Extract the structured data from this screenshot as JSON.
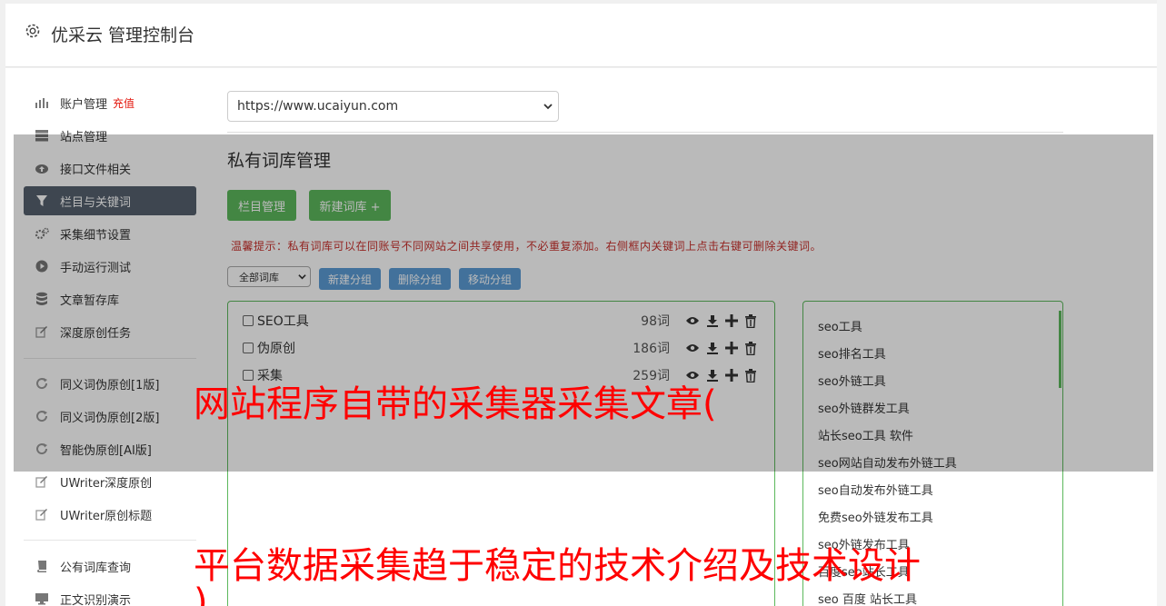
{
  "header": {
    "title": "优采云 管理控制台"
  },
  "sidebar": {
    "items": [
      {
        "label": "账户管理",
        "badge": "充值",
        "icon": "bar-chart-icon"
      },
      {
        "label": "站点管理",
        "icon": "server-icon"
      },
      {
        "label": "接口文件相关",
        "icon": "cloud-upload-icon"
      },
      {
        "label": "栏目与关键词",
        "icon": "filter-icon",
        "active": true
      },
      {
        "label": "采集细节设置",
        "icon": "cogs-icon"
      },
      {
        "label": "手动运行测试",
        "icon": "play-circle-icon"
      },
      {
        "label": "文章暂存库",
        "icon": "database-icon"
      },
      {
        "label": "深度原创任务",
        "icon": "edit-icon"
      },
      {
        "label": "同义词伪原创[1版]",
        "icon": "refresh-icon"
      },
      {
        "label": "同义词伪原创[2版]",
        "icon": "refresh-icon"
      },
      {
        "label": "智能伪原创[AI版]",
        "icon": "refresh-icon"
      },
      {
        "label": "UWriter深度原创",
        "icon": "edit-icon"
      },
      {
        "label": "UWriter原创标题",
        "icon": "edit-icon"
      },
      {
        "label": "公有词库查询",
        "icon": "book-icon"
      },
      {
        "label": "正文识别演示",
        "icon": "desktop-icon"
      }
    ]
  },
  "site_select": {
    "value": "https://www.ucaiyun.com"
  },
  "page_title": "私有词库管理",
  "buttons": {
    "column_manage": "栏目管理",
    "new_library": "新建词库 +"
  },
  "tip": "温馨提示：私有词库可以在同账号不同网站之间共享使用，不必重复添加。右侧框内关键词上点击右键可删除关键词。",
  "group_select": {
    "value": "全部词库"
  },
  "group_buttons": {
    "new_group": "新建分组",
    "delete_group": "删除分组",
    "move_group": "移动分组"
  },
  "libraries": [
    {
      "name": "SEO工具",
      "count": "98词"
    },
    {
      "name": "伪原创",
      "count": "186词"
    },
    {
      "name": "采集",
      "count": "259词"
    }
  ],
  "keywords": [
    "seo工具",
    "seo排名工具",
    "seo外链工具",
    "seo外链群发工具",
    "站长seo工具 软件",
    "seo网站自动发布外链工具",
    "seo自动发布外链工具",
    "免费seo外链发布工具",
    "seo外链发布工具",
    "百度seo站长工具",
    "seo 百度 站长工具"
  ],
  "captions": {
    "line1": "网站程序自带的采集器采集文章(",
    "line2": "平台数据采集趋于稳定的技术介绍及技术设计",
    "line3": ")"
  },
  "colors": {
    "active_nav": "#55606e",
    "green": "#5cb85c",
    "blue": "#5b9bd5",
    "caption_red": "#ff0000",
    "badge_red": "#e3150b"
  }
}
